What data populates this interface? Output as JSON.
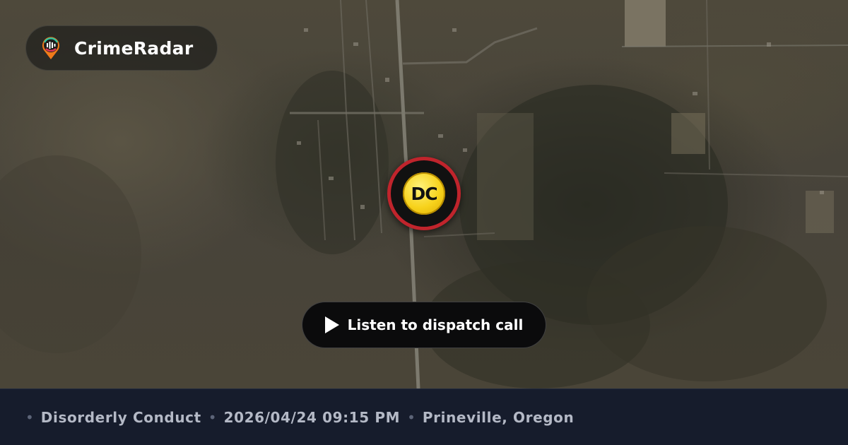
{
  "brand": {
    "name": "CrimeRadar",
    "logo_icon": "radar-pin-icon"
  },
  "incident": {
    "badge_code": "DC",
    "badge_color": "#f7d21b",
    "ring_color": "#c0242c",
    "type": "Disorderly Conduct",
    "datetime": "2026/04/24 09:15 PM",
    "location": "Prineville, Oregon"
  },
  "actions": {
    "listen_label": "Listen to dispatch call",
    "listen_icon": "play-icon"
  },
  "footer": {
    "separator": "•"
  }
}
